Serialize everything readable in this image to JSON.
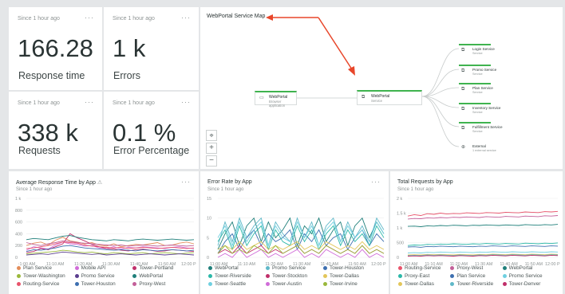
{
  "kpis": [
    {
      "since": "Since 1 hour ago",
      "value": "166.28",
      "label": "Response time"
    },
    {
      "since": "Since 1 hour ago",
      "value": "1 k",
      "label": "Errors"
    },
    {
      "since": "Since 1 hour ago",
      "value": "338 k",
      "label": "Requests"
    },
    {
      "since": "Since 1 hour ago",
      "value": "0.1 %",
      "label": "Error Percentage"
    }
  ],
  "more_label": "···",
  "service_map": {
    "title": "WebPortal Service Map",
    "source": {
      "name": "WebPortal",
      "sub": "Browser application"
    },
    "center": {
      "name": "WebPortal",
      "sub": "Service"
    },
    "services": [
      {
        "name": "Login Service",
        "sub": "Service"
      },
      {
        "name": "Promo Service",
        "sub": "Service"
      },
      {
        "name": "Plan Service",
        "sub": "Service"
      },
      {
        "name": "Inventory Service",
        "sub": "Service"
      },
      {
        "name": "Fulfillment Service",
        "sub": "Service"
      },
      {
        "name": "External",
        "sub": "1 external service"
      }
    ],
    "zoom": {
      "locate": "⌖",
      "in": "+",
      "out": "−"
    },
    "arrow_color": "#e8462a"
  },
  "charts": [
    {
      "title": "Average Response Time by App",
      "warning_icon": "⚠",
      "since": "Since 1 hour ago",
      "chart_data": {
        "type": "line",
        "y_ticks": [
          "1 k",
          "800",
          "600",
          "400",
          "200",
          "0"
        ],
        "ylim": [
          0,
          1000
        ],
        "x_ticks": [
          ":1:00 AM",
          "11:10 AM",
          "11:20 AM",
          "11:30 AM",
          "11:40 AM",
          "11:50 AM",
          "12:00 P"
        ],
        "series": [
          {
            "name": "Plan Service",
            "color": "#e38d5a",
            "values": [
              200,
              240,
              260,
              210,
              290,
              340,
              280,
              260,
              230,
              250,
              210,
              190,
              230,
              180,
              200,
              220,
              210,
              230,
              250,
              200,
              210,
              240,
              260,
              230
            ]
          },
          {
            "name": "Mobile API",
            "color": "#d06cd8",
            "values": [
              120,
              180,
              160,
              140,
              210,
              260,
              230,
              220,
              190,
              200,
              160,
              150,
              180,
              140,
              170,
              160,
              180,
              170,
              160,
              150,
              170,
              180,
              160,
              150
            ]
          },
          {
            "name": "Tower-Portland",
            "color": "#c02f6a",
            "values": [
              80,
              100,
              150,
              130,
              180,
              230,
              400,
              330,
              280,
              220,
              180,
              150,
              140,
              120,
              110,
              130,
              140,
              120,
              100,
              110,
              130,
              120,
              110,
              100
            ]
          },
          {
            "name": "Tower-Washington",
            "color": "#9ab83b",
            "values": [
              60,
              70,
              80,
              90,
              100,
              120,
              110,
              90,
              80,
              90,
              70,
              60,
              80,
              70,
              60,
              70,
              80,
              60,
              70,
              80,
              70,
              60,
              70,
              80
            ]
          },
          {
            "name": "Promo Service",
            "color": "#5a3d8e",
            "values": [
              40,
              50,
              60,
              50,
              70,
              90,
              80,
              70,
              60,
              50,
              60,
              40,
              50,
              60,
              50,
              40,
              50,
              60,
              50,
              40,
              50,
              60,
              50,
              40
            ]
          },
          {
            "name": "WebPortal",
            "color": "#1f7f7a",
            "values": [
              300,
              320,
              310,
              300,
              330,
              360,
              370,
              340,
              320,
              300,
              290,
              280,
              300,
              290,
              280,
              300,
              310,
              300,
              290,
              300,
              310,
              300,
              290,
              300
            ]
          },
          {
            "name": "Routing-Service",
            "color": "#e8536b",
            "values": [
              150,
              160,
              180,
              200,
              230,
              260,
              250,
              240,
              210,
              190,
              180,
              170,
              160,
              170,
              150,
              160,
              170,
              160,
              150,
              160,
              170,
              160,
              150,
              160
            ]
          },
          {
            "name": "Tower-Houston",
            "color": "#3d6fb0",
            "values": [
              100,
              130,
              120,
              140,
              160,
              190,
              200,
              180,
              160,
              150,
              140,
              130,
              120,
              130,
              120,
              110,
              130,
              120,
              110,
              120,
              130,
              120,
              110,
              120
            ]
          },
          {
            "name": "Proxy-West",
            "color": "#c35f99",
            "values": [
              250,
              220,
              200,
              230,
              250,
              280,
              270,
              250,
              240,
              230,
              220,
              210,
              200,
              210,
              190,
              200,
              210,
              200,
              190,
              200,
              210,
              200,
              190,
              200
            ]
          }
        ]
      }
    },
    {
      "title": "Error Rate by App",
      "since": "Since 1 hour ago",
      "chart_data": {
        "type": "line",
        "y_ticks": [
          "15",
          "10",
          "5",
          "0"
        ],
        "ylim": [
          0,
          15
        ],
        "x_ticks": [
          "11:00 AM",
          "11:10 AM",
          "11:20 AM",
          "11:30 AM",
          "11:40 AM",
          "11:50 AM",
          "12:00 P"
        ],
        "series": [
          {
            "name": "WebPortal",
            "color": "#1f7f7a",
            "values": [
              2,
              6,
              9,
              3,
              8,
              10,
              4,
              9,
              5,
              7,
              10,
              3,
              8,
              6,
              10,
              4,
              7,
              9,
              3,
              8,
              10,
              5,
              9,
              6
            ]
          },
          {
            "name": "Promo Service",
            "color": "#5fb8c8",
            "values": [
              3,
              9,
              4,
              10,
              5,
              8,
              10,
              3,
              9,
              6,
              4,
              10,
              5,
              9,
              3,
              8,
              10,
              4,
              9,
              5,
              8,
              4,
              10,
              7
            ]
          },
          {
            "name": "Tower-Houston",
            "color": "#3d6fb0",
            "values": [
              1,
              4,
              6,
              2,
              5,
              7,
              3,
              6,
              4,
              5,
              7,
              2,
              6,
              4,
              7,
              3,
              5,
              6,
              2,
              5,
              7,
              3,
              6,
              4
            ]
          },
          {
            "name": "Tower-Riverside",
            "color": "#2bb8a8",
            "values": [
              4,
              7,
              2,
              8,
              3,
              6,
              8,
              2,
              7,
              4,
              3,
              8,
              4,
              7,
              2,
              6,
              8,
              3,
              7,
              4,
              6,
              3,
              8,
              5
            ]
          },
          {
            "name": "Tower-Stockton",
            "color": "#c02f6a",
            "values": [
              1,
              2,
              1,
              3,
              1,
              2,
              3,
              1,
              2,
              1,
              2,
              3,
              1,
              2,
              1,
              3,
              2,
              1,
              2,
              1,
              3,
              1,
              2,
              1
            ]
          },
          {
            "name": "Tower-Dallas",
            "color": "#e3c65a",
            "values": [
              2,
              3,
              2,
              4,
              2,
              3,
              4,
              2,
              3,
              2,
              3,
              4,
              2,
              3,
              2,
              4,
              3,
              2,
              3,
              2,
              4,
              2,
              3,
              2
            ]
          },
          {
            "name": "Tower-Seattle",
            "color": "#6fd0e0",
            "values": [
              5,
              8,
              3,
              9,
              4,
              7,
              9,
              3,
              8,
              5,
              4,
              9,
              5,
              8,
              3,
              7,
              9,
              4,
              8,
              5,
              7,
              4,
              9,
              6
            ]
          },
          {
            "name": "Tower-Austin",
            "color": "#d06cd8",
            "values": [
              0,
              1,
              0,
              2,
              0,
              1,
              2,
              0,
              1,
              0,
              1,
              2,
              0,
              1,
              0,
              2,
              1,
              0,
              1,
              0,
              2,
              0,
              1,
              0
            ]
          },
          {
            "name": "Tower-Irvine",
            "color": "#9ab83b",
            "values": [
              1,
              3,
              1,
              2,
              1,
              3,
              2,
              1,
              3,
              1,
              2,
              3,
              1,
              2,
              1,
              3,
              2,
              1,
              2,
              1,
              3,
              1,
              2,
              1
            ]
          }
        ]
      }
    },
    {
      "title": "Total Requests by App",
      "since": "Since 1 hour ago",
      "chart_data": {
        "type": "line",
        "y_ticks": [
          "2 k",
          "1.5 k",
          "1 k",
          "500",
          "0"
        ],
        "ylim": [
          0,
          2000
        ],
        "x_ticks": [
          "11:00 AM",
          "11:10 AM",
          "11:20 AM",
          "11:30 AM",
          "11:40 AM",
          "11:50 AM",
          "12:00 P"
        ],
        "series": [
          {
            "name": "Routing-Service",
            "color": "#e8536b",
            "values": [
              1400,
              1450,
              1420,
              1480,
              1460,
              1500,
              1470,
              1490,
              1480,
              1510,
              1500,
              1490,
              1520,
              1510,
              1500,
              1530,
              1520,
              1510,
              1540,
              1530,
              1520,
              1550,
              1540,
              1560
            ]
          },
          {
            "name": "Proxy-West",
            "color": "#c35f99",
            "values": [
              1300,
              1320,
              1310,
              1340,
              1330,
              1350,
              1340,
              1360,
              1350,
              1370,
              1360,
              1350,
              1380,
              1370,
              1360,
              1390,
              1380,
              1370,
              1400,
              1390,
              1380,
              1410,
              1400,
              1420
            ]
          },
          {
            "name": "WebPortal",
            "color": "#1f7f7a",
            "values": [
              1050,
              1060,
              1040,
              1070,
              1060,
              1080,
              1070,
              1090,
              1080,
              1070,
              1090,
              1080,
              1100,
              1090,
              1080,
              1100,
              1090,
              1080,
              1110,
              1100,
              1090,
              1110,
              1100,
              1120
            ]
          },
          {
            "name": "Proxy-East",
            "color": "#2bb8a8",
            "values": [
              400,
              420,
              410,
              440,
              430,
              450,
              440,
              460,
              450,
              440,
              460,
              450,
              470,
              460,
              450,
              470,
              460,
              450,
              480,
              470,
              460,
              480,
              470,
              490
            ]
          },
          {
            "name": "Plan Service",
            "color": "#3d6fb0",
            "values": [
              350,
              360,
              340,
              370,
              360,
              380,
              370,
              360,
              380,
              370,
              360,
              380,
              370,
              390,
              380,
              370,
              390,
              380,
              370,
              390,
              380,
              370,
              390,
              380
            ]
          },
          {
            "name": "Promo Service",
            "color": "#6fd0e0",
            "values": [
              150,
              160,
              150,
              170,
              160,
              180,
              170,
              160,
              180,
              170,
              160,
              180,
              170,
              190,
              180,
              170,
              190,
              180,
              170,
              190,
              180,
              170,
              190,
              180
            ]
          },
          {
            "name": "Tower-Dallas",
            "color": "#e3c65a",
            "values": [
              80,
              90,
              80,
              100,
              90,
              100,
              90,
              80,
              100,
              90,
              80,
              100,
              90,
              110,
              100,
              90,
              110,
              100,
              90,
              110,
              100,
              90,
              110,
              100
            ]
          },
          {
            "name": "Tower-Riverside",
            "color": "#5fb8c8",
            "values": [
              60,
              70,
              60,
              80,
              70,
              80,
              70,
              60,
              80,
              70,
              60,
              80,
              70,
              90,
              80,
              70,
              90,
              80,
              70,
              90,
              80,
              70,
              90,
              80
            ]
          },
          {
            "name": "Tower-Denver",
            "color": "#c02f6a",
            "values": [
              40,
              50,
              40,
              60,
              50,
              60,
              50,
              40,
              60,
              50,
              40,
              60,
              50,
              70,
              60,
              50,
              70,
              60,
              50,
              70,
              60,
              50,
              70,
              60
            ]
          }
        ]
      }
    }
  ]
}
